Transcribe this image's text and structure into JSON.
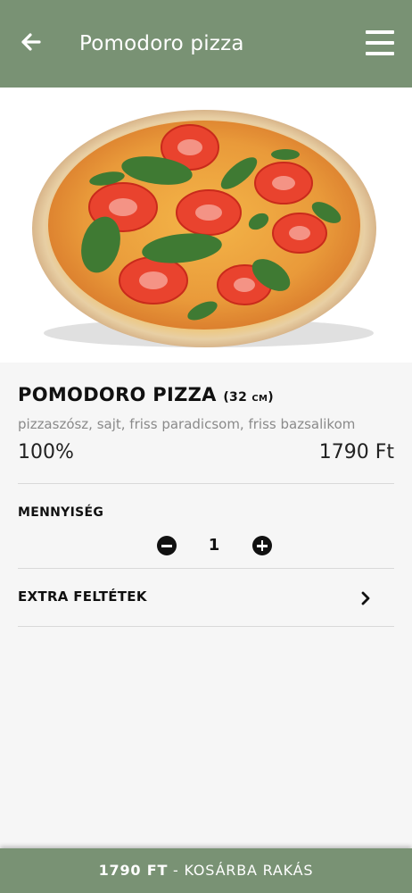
{
  "header": {
    "title": "Pomodoro pizza",
    "back_icon": "back-arrow-icon",
    "menu_icon": "hamburger-menu-icon"
  },
  "product": {
    "name": "POMODORO PIZZA",
    "size": "(32 cm)",
    "description": "pizzaszósz, sajt, friss paradicsom, friss bazsalikom",
    "percent": "100%",
    "price": "1790 Ft"
  },
  "quantity": {
    "label": "MENNYISÉG",
    "value": "1"
  },
  "extras": {
    "label": "EXTRA FELTÉTEK"
  },
  "footer": {
    "price": "1790 FT",
    "action": " - KOSÁRBA RAKÁS"
  },
  "colors": {
    "brand": "#799274",
    "background": "#f6f6f6"
  }
}
